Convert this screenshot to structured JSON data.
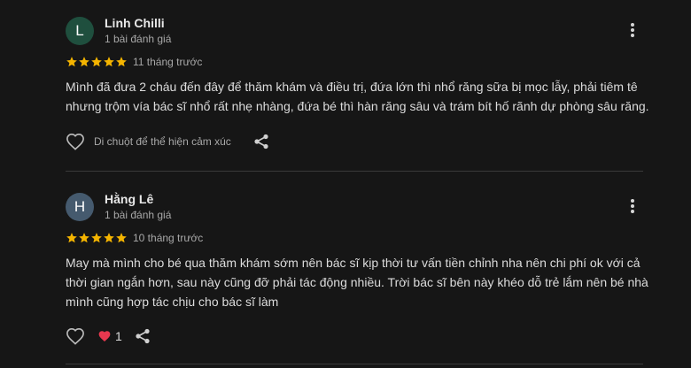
{
  "reviews": [
    {
      "avatar_letter": "L",
      "avatar_color": "#1f4f3e",
      "name": "Linh Chilli",
      "review_count": "1 bài đánh giá",
      "rating": 5,
      "time": "11 tháng trước",
      "text_lines": [
        "Mình đã đưa 2 cháu đến đây để thăm khám và điều trị, đứa lớn thì nhổ răng sữa bị mọc lẫy, phải tiêm tê",
        "nhưng trộm vía bác sĩ nhổ rất nhẹ nhàng, đứa bé thì hàn răng sâu và trám bít hố rãnh dự phòng sâu răng."
      ],
      "like_hint": "Di chuột để thể hiện cảm xúc",
      "like_count": ""
    },
    {
      "avatar_letter": "H",
      "avatar_color": "#455a6e",
      "name": "Hằng Lê",
      "review_count": "1 bài đánh giá",
      "rating": 5,
      "time": "10 tháng trước",
      "text_lines": [
        "May mà mình cho bé qua thăm khám sớm nên bác sĩ kịp thời tư vấn tiền chỉnh nha nên chi phí ok với cả",
        "thời gian ngắn hơn, sau này cũng đỡ phải tác động nhiều. Trời bác sĩ bên này khéo dỗ trẻ lắm nên bé nhà",
        "mình cũng hợp tác chịu cho bác sĩ làm"
      ],
      "like_hint": "",
      "like_count": "1"
    }
  ],
  "colors": {
    "star": "#f4b400",
    "heart_reaction": "#e8384f",
    "background": "#161616"
  },
  "icons": {
    "more": "more-vert-icon",
    "like": "heart-outline-icon",
    "reaction": "heart-filled-icon",
    "share": "share-icon",
    "star": "star-icon"
  }
}
